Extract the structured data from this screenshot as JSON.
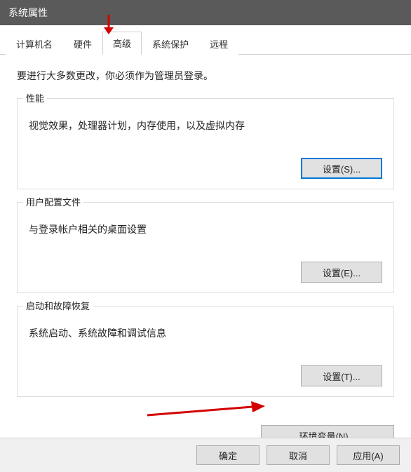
{
  "title": "系统属性",
  "tabs": {
    "computer_name": "计算机名",
    "hardware": "硬件",
    "advanced": "高级",
    "system_protection": "系统保护",
    "remote": "远程"
  },
  "note": "要进行大多数更改，你必须作为管理员登录。",
  "perf": {
    "title": "性能",
    "desc": "视觉效果，处理器计划，内存使用，以及虚拟内存",
    "button": "设置(S)..."
  },
  "profile": {
    "title": "用户配置文件",
    "desc": "与登录帐户相关的桌面设置",
    "button": "设置(E)..."
  },
  "startup": {
    "title": "启动和故障恢复",
    "desc": "系统启动、系统故障和调试信息",
    "button": "设置(T)..."
  },
  "env_button": "环境变量(N)...",
  "bottom": {
    "ok": "确定",
    "cancel": "取消",
    "apply": "应用(A)"
  }
}
